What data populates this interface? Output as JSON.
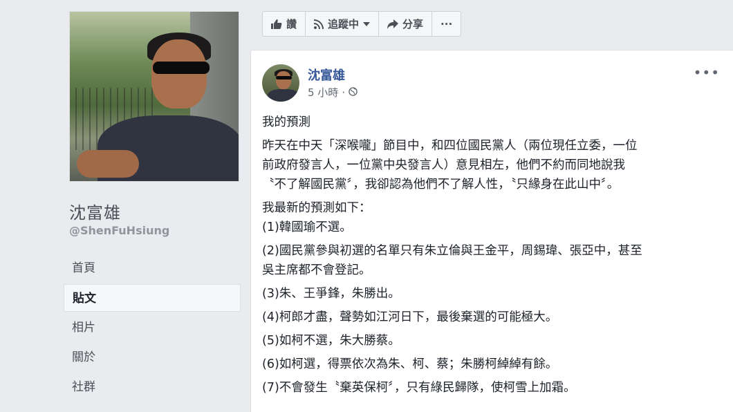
{
  "profile": {
    "name": "沈富雄",
    "handle": "@ShenFuHsiung"
  },
  "nav": {
    "items": [
      {
        "label": "首頁",
        "active": false
      },
      {
        "label": "貼文",
        "active": true
      },
      {
        "label": "相片",
        "active": false
      },
      {
        "label": "關於",
        "active": false
      },
      {
        "label": "社群",
        "active": false
      }
    ]
  },
  "action_bar": {
    "like_label": "讚",
    "follow_label": "追蹤中",
    "share_label": "分享",
    "more_label": "···"
  },
  "post": {
    "author": "沈富雄",
    "time": "5 小時",
    "separator": "·",
    "more": "•••",
    "lines": [
      "我的預測",
      "昨天在中天「深喉嚨」節目中，和四位國民黨人（兩位現任立委，一位",
      "前政府發言人，一位黨中央發言人）意見相左，他們不約而同地說我",
      "〝不了解國民黨〞，我卻認為他們不了解人性，〝只緣身在此山中〞。",
      "我最新的預測如下：",
      "(1)韓國瑜不選。",
      "(2)國民黨參與初選的名單只有朱立倫與王金平，周錫瑋、張亞中，甚至",
      "吳主席都不會登記。",
      "(3)朱、王爭鋒，朱勝出。",
      "(4)柯郎才盡，聲勢如江河日下，最後棄選的可能極大。",
      "(5)如柯不選，朱大勝蔡。",
      "(6)如柯選，得票依次為朱、柯、蔡；朱勝柯綽綽有餘。",
      "(7)不會發生〝棄英保柯〞，只有綠民歸隊，使柯雪上加霜。"
    ]
  },
  "colors": {
    "link": "#365899",
    "page_bg": "#e9ebee",
    "card_bg": "#ffffff"
  }
}
